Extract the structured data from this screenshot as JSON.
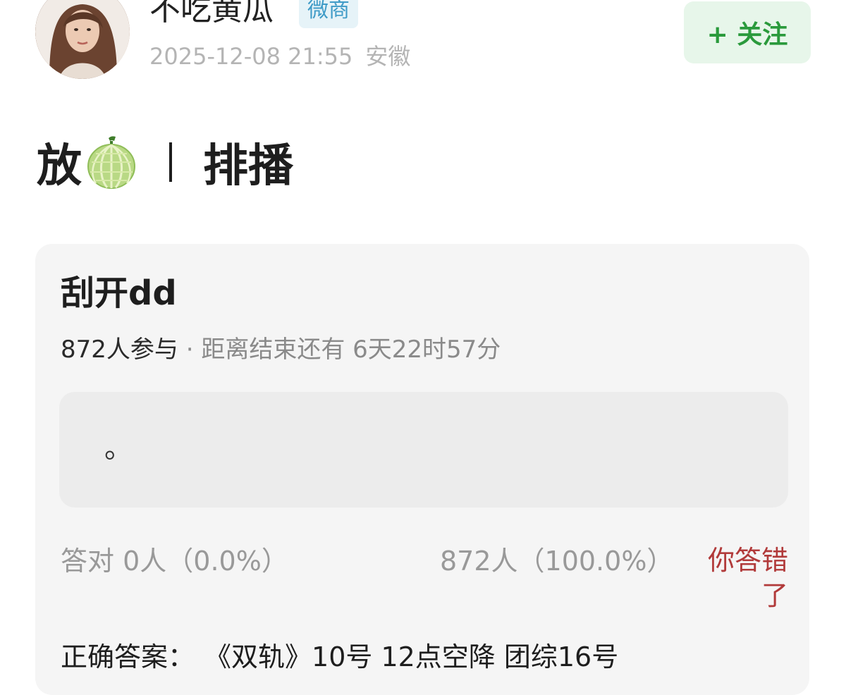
{
  "author": {
    "name": "不吃黄瓜",
    "badge": "微商",
    "timestamp": "2025-12-08 21:55",
    "location": "安徽"
  },
  "follow": {
    "label": "+ 关注"
  },
  "post": {
    "text_before_emoji": "放",
    "emoji": "melon-emoji",
    "separator": "丨",
    "text_after": "排播"
  },
  "quiz": {
    "title": "刮开dd",
    "participants": "872人参与",
    "countdown": " · 距离结束还有 6天22时57分",
    "option_text": "。",
    "correct_label": "答对",
    "correct_result": "0人（0.0%）",
    "wrong_result": "872人（100.0%）",
    "wrong_tag": "你答错了",
    "answer_label": "正确答案：",
    "answer_value": "《双轨》10号 12点空降 团综16号"
  },
  "colors": {
    "follow_text": "#2a9a3c",
    "follow_bg": "#e7f6ea",
    "badge_text": "#3f9bc7",
    "wrong_tag": "#b13a3a"
  }
}
